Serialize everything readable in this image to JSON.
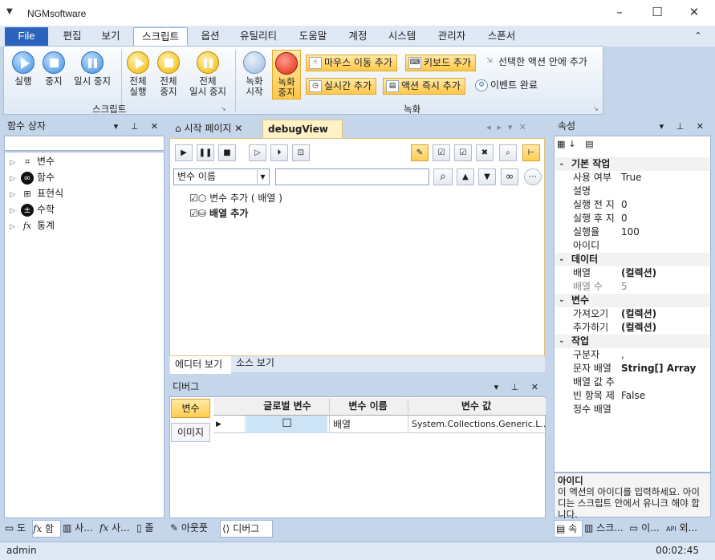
{
  "window": {
    "title": "NGMsoftware",
    "icon": "▼"
  },
  "menu": {
    "file": "File",
    "tabs": [
      "편집",
      "보기",
      "스크립트",
      "옵션",
      "유틸리티",
      "도움말",
      "계정",
      "시스템",
      "관리자",
      "스폰서"
    ],
    "active_index": 2
  },
  "ribbon": {
    "script_group": {
      "label": "스크립트",
      "buttons": [
        "실행",
        "중지",
        "일시 중지",
        "전체\n실행",
        "전체\n중지",
        "전체\n일시 중지"
      ]
    },
    "record_group": {
      "label": "녹화",
      "buttons": [
        "녹화\n시작",
        "녹화\n중지"
      ],
      "small": [
        "마우스 이동 추가",
        "키보드 추가",
        "선택한 액션 안에 추가",
        "실시간 추가",
        "액션 즉시 추가",
        "이벤트 완료"
      ]
    }
  },
  "left_panel": {
    "title": "함수 상자",
    "items": [
      {
        "label": "변수",
        "icon": "variable-icon"
      },
      {
        "label": "함수",
        "icon": "function-icon"
      },
      {
        "label": "표현식",
        "icon": "expression-icon"
      },
      {
        "label": "수학",
        "icon": "math-icon"
      },
      {
        "label": "통계",
        "icon": "statistics-icon"
      }
    ],
    "bottom_tabs": [
      "도",
      "함",
      "사...",
      "사...",
      "졸"
    ]
  },
  "documents": {
    "tabs": [
      "시작 페이지",
      "debugView"
    ],
    "active_index": 1,
    "field_select": "변수 이름",
    "search_value": "",
    "tree": [
      {
        "label": "변수 추가 ( 배열 )",
        "bold": false
      },
      {
        "label": "배열 추가",
        "bold": true
      }
    ],
    "view_tabs": [
      "에디터 보기",
      "소스 보기"
    ]
  },
  "debug_panel": {
    "title": "디버그",
    "side_tabs": [
      "변수",
      "이미지"
    ],
    "columns": [
      "글로벌 변수",
      "변수 이름",
      "변수 값"
    ],
    "rows": [
      {
        "global": false,
        "name": "배열",
        "value": "System.Collections.Generic.L..."
      }
    ],
    "bottom_tabs": [
      "아웃풋",
      "디버그"
    ]
  },
  "properties": {
    "title": "속성",
    "categories": [
      {
        "name": "기본 작업",
        "rows": [
          [
            "사용 여부",
            "True",
            false
          ],
          [
            "설명",
            "",
            false
          ],
          [
            "실행 전 지",
            "0",
            false
          ],
          [
            "실행 후 지",
            "0",
            false
          ],
          [
            "실행율",
            "100",
            false
          ],
          [
            "아이디",
            "",
            false
          ]
        ]
      },
      {
        "name": "데이터",
        "rows": [
          [
            "배열",
            "(컬렉션)",
            true
          ],
          [
            "배열 수",
            "5",
            false
          ]
        ]
      },
      {
        "name": "변수",
        "rows": [
          [
            "가져오기",
            "(컬렉션)",
            true
          ],
          [
            "추가하기",
            "(컬렉션)",
            true
          ]
        ]
      },
      {
        "name": "작업",
        "rows": [
          [
            "구분자",
            ",",
            false
          ],
          [
            "문자 배열",
            "String[] Array",
            true
          ],
          [
            "배열 값 추",
            "",
            false
          ],
          [
            "빈 항목 제",
            "False",
            false
          ],
          [
            "정수 배열",
            "",
            false
          ]
        ]
      }
    ],
    "desc_title": "아이디",
    "desc_text": "이 액션의 아이디를 입력하세요. 아이디는 스크립트 안에서 유니크 해야 합니다.",
    "bottom_tabs": [
      "속",
      "스크...",
      "이...",
      "외..."
    ]
  },
  "status": {
    "user": "admin",
    "time": "00:02:45"
  }
}
